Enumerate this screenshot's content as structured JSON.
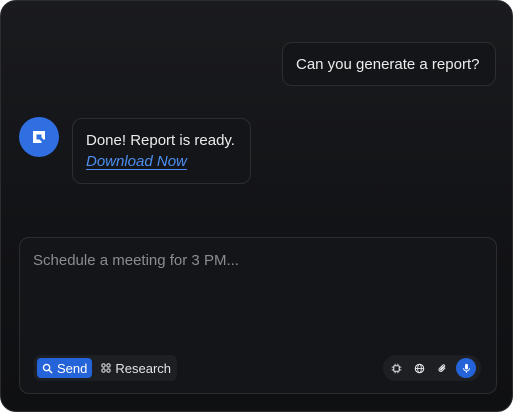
{
  "messages": {
    "user": {
      "text": "Can you generate a report?"
    },
    "assistant": {
      "avatar_icon": "assistant-logo-icon",
      "text": "Done! Report is ready.",
      "link_label": "Download Now"
    }
  },
  "composer": {
    "placeholder": "Schedule a meeting for 3 PM...",
    "value": "",
    "modes": [
      {
        "label": "Send",
        "icon": "search-icon",
        "active": true
      },
      {
        "label": "Research",
        "icon": "research-icon",
        "active": false
      }
    ],
    "tools": [
      {
        "icon": "chip-icon"
      },
      {
        "icon": "globe-icon"
      },
      {
        "icon": "paperclip-icon"
      },
      {
        "icon": "microphone-icon",
        "active": true
      }
    ]
  },
  "colors": {
    "accent": "#2563d9",
    "avatar": "#2f6fe2",
    "link": "#4d8ef0",
    "background": "#131417",
    "surface": "#141518",
    "border": "#2b2d31"
  }
}
